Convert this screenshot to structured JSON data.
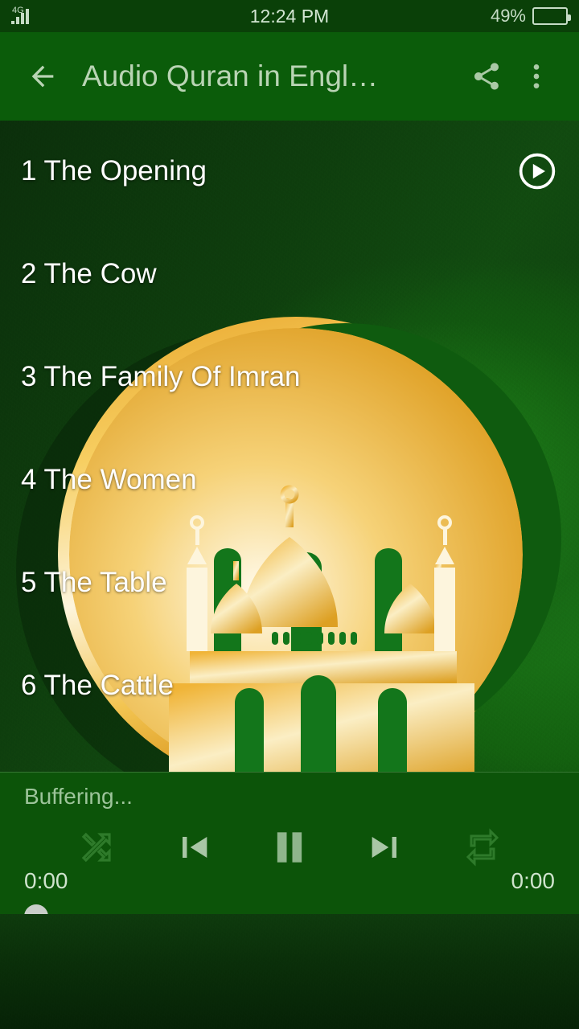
{
  "status_bar": {
    "network": "4G",
    "network_icon": "signal-bars-icon",
    "time": "12:24 PM",
    "battery_percent": "49%",
    "battery_level": 49,
    "battery_icon": "battery-icon"
  },
  "app_bar": {
    "back_icon": "arrow-left-icon",
    "title": "Audio Quran in Engl…",
    "share_icon": "share-icon",
    "overflow_icon": "more-vertical-icon"
  },
  "artwork": {
    "description": "gold-crescent-and-mosque-logo",
    "gold_light": "#fdf3d8",
    "gold_mid": "#f2c044",
    "gold_dark": "#d89a1c",
    "green_bg": "#126012"
  },
  "tracks": [
    {
      "number": "1",
      "title": "The Opening",
      "label": "1 The Opening",
      "playing": true,
      "play_icon": "play-circle-icon"
    },
    {
      "number": "2",
      "title": "The Cow",
      "label": "2 The Cow",
      "playing": false
    },
    {
      "number": "3",
      "title": "The Family Of Imran",
      "label": "3 The Family Of Imran",
      "playing": false
    },
    {
      "number": "4",
      "title": "The Women",
      "label": "4 The Women",
      "playing": false
    },
    {
      "number": "5",
      "title": "The Table",
      "label": "5 The Table",
      "playing": false
    },
    {
      "number": "6",
      "title": "The Cattle",
      "label": "6 The Cattle",
      "playing": false
    }
  ],
  "player": {
    "status": "Buffering...",
    "shuffle_icon": "shuffle-icon",
    "previous_icon": "skip-previous-icon",
    "playpause_icon": "pause-icon",
    "next_icon": "skip-next-icon",
    "repeat_icon": "repeat-icon",
    "current_time": "0:00",
    "duration": "0:00",
    "progress_percent": 0,
    "accent_color": "#0b5c0a",
    "control_color": "#a9c6a6",
    "disabled_color": "#2f7a2b"
  }
}
